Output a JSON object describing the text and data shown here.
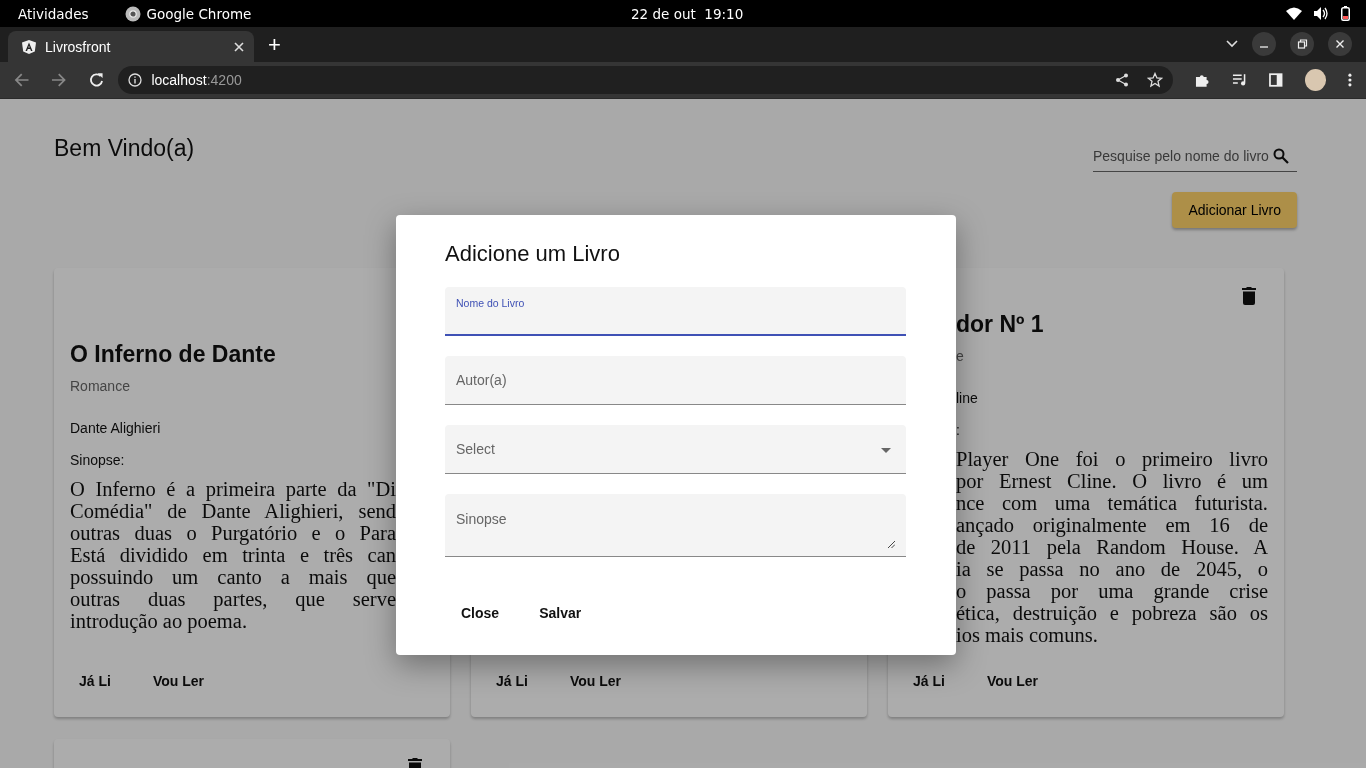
{
  "system_bar": {
    "activities": "Atividades",
    "app": "Google Chrome",
    "clock": "22 de out  19:10"
  },
  "browser": {
    "tab": {
      "title": "Livrosfront",
      "selected": true
    },
    "new_tab": "+",
    "url": {
      "host": "localhost",
      "port": ":4200"
    }
  },
  "page": {
    "heading": "Bem Vindo(a)",
    "search": {
      "placeholder": "Pesquise pelo nome do livro"
    },
    "add_button": "Adicionar Livro",
    "cards": [
      {
        "kind": "covered-right",
        "delete_button": false,
        "title": "O Inferno de Dante",
        "genre": "Romance",
        "author": "Dante Alighieri",
        "synopsis_label": "Sinopse:",
        "synopsis_lines": [
          "O Inferno é a primeira parte da \"Di",
          "Comédia\" de Dante Alighieri, send",
          "outras duas o Purgatório e o Para",
          "Está dividido em trinta e três can",
          "possuindo um canto a mais que",
          "outras duas partes, que serve",
          "introdução ao poema."
        ],
        "actions": [
          "Já Li",
          "Vou Ler"
        ]
      },
      {
        "kind": "covered-top",
        "delete_button": false,
        "actions": [
          "Já Li",
          "Vou Ler"
        ]
      },
      {
        "kind": "covered-left",
        "delete_button": true,
        "title": "dor Nº 1",
        "genre": "e",
        "author": "line",
        "synopsis_label": ":",
        "synopsis_lines": [
          "Player One foi o primeiro livro",
          "por Ernest Cline. O livro é um",
          "nce com uma temática futurista.",
          "ançado originalmente em 16 de",
          "de 2011 pela Random House. A",
          "ia se passa no ano de 2045, o",
          "o passa por uma grande crise",
          "ética, destruição e pobreza são os",
          "ios mais comuns."
        ],
        "actions": [
          "Já Li",
          "Vou Ler"
        ]
      },
      {
        "kind": "covered-bottom",
        "delete_button": true
      }
    ]
  },
  "dialog": {
    "title": "Adicione um Livro",
    "fields": [
      {
        "kind": "input",
        "label": "Nome do Livro",
        "focused": true
      },
      {
        "kind": "input",
        "label": "Autor(a)",
        "focused": false
      },
      {
        "kind": "select",
        "label": "Select",
        "focused": false
      },
      {
        "kind": "textarea",
        "label": "Sinopse",
        "focused": false
      }
    ],
    "buttons": [
      "Close",
      "Salvar"
    ]
  }
}
